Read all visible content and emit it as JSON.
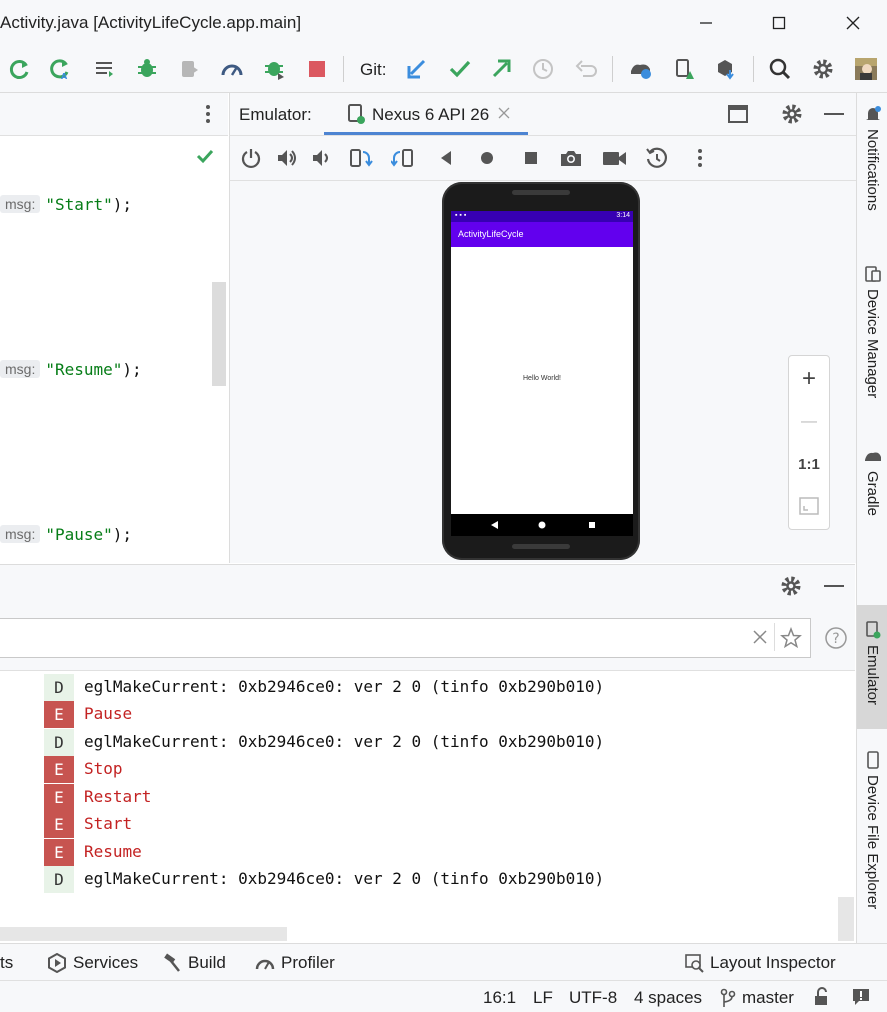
{
  "window": {
    "title": "Activity.java [ActivityLifeCycle.app.main]",
    "minimize_icon": "minimize-icon",
    "maximize_icon": "maximize-icon",
    "close_icon": "close-icon"
  },
  "toolbar": {
    "git_label": "Git:",
    "icons": [
      "rerun-icon",
      "apply-changes-icon",
      "logcat-icon",
      "debug-icon",
      "attach-debugger-icon",
      "profile-icon",
      "debug-attach-icon",
      "stop-icon",
      "git-update-icon",
      "git-commit-icon",
      "git-push-icon",
      "git-history-icon",
      "git-rollback-icon",
      "device-manager-icon",
      "sync-icon",
      "sdk-manager-icon",
      "search-icon",
      "settings-icon",
      "avatar"
    ],
    "accent_green": "#3ba55d",
    "accent_blue": "#3b8ddd",
    "stop_red": "#db5860"
  },
  "editor": {
    "lines": [
      {
        "hint": "msg:",
        "string": "\"Start\"",
        "tail": ");"
      },
      {
        "hint": "msg:",
        "string": "\"Resume\"",
        "tail": ");"
      },
      {
        "hint": "msg:",
        "string": "\"Pause\"",
        "tail": ");"
      }
    ]
  },
  "emulator": {
    "label": "Emulator:",
    "tab_label": "Nexus 6 API 26",
    "controls": [
      "power-icon",
      "volume-up-icon",
      "volume-down-icon",
      "rotate-left-icon",
      "rotate-right-icon",
      "back-icon",
      "home-icon",
      "overview-icon",
      "screenshot-icon",
      "screen-record-icon",
      "snapshot-icon",
      "more-icon"
    ],
    "phone": {
      "status_time": "3:14",
      "app_title": "ActivityLifeCycle",
      "hello_text": "Hello World!",
      "app_bar_color": "#6200ee",
      "status_bar_color": "#3700b3"
    },
    "zoom": {
      "zoom_in": "+",
      "zoom_out": "—",
      "actual_size": "1:1"
    }
  },
  "right_tabs": [
    {
      "label": "Notifications",
      "icon": "bell-icon"
    },
    {
      "label": "Device Manager",
      "icon": "device-manager-icon"
    },
    {
      "label": "Gradle",
      "icon": "gradle-icon"
    },
    {
      "label": "Emulator",
      "icon": "emulator-icon"
    },
    {
      "label": "Device File Explorer",
      "icon": "device-file-explorer-icon"
    }
  ],
  "logcat": {
    "search_placeholder": "",
    "lines": [
      {
        "level": "D",
        "message": "eglMakeCurrent: 0xb2946ce0: ver 2 0 (tinfo 0xb290b010)"
      },
      {
        "level": "E",
        "message": "Pause"
      },
      {
        "level": "D",
        "message": "eglMakeCurrent: 0xb2946ce0: ver 2 0 (tinfo 0xb290b010)"
      },
      {
        "level": "E",
        "message": "Stop"
      },
      {
        "level": "E",
        "message": "Restart"
      },
      {
        "level": "E",
        "message": "Start"
      },
      {
        "level": "E",
        "message": "Resume"
      },
      {
        "level": "D",
        "message": "eglMakeCurrent: 0xb2946ce0: ver 2 0 (tinfo 0xb290b010)"
      }
    ],
    "error_color": "#c75450"
  },
  "bottom_tools": {
    "partial": "ts",
    "services": "Services",
    "build": "Build",
    "profiler": "Profiler",
    "layout_inspector": "Layout Inspector"
  },
  "status_bar": {
    "position": "16:1",
    "line_sep": "LF",
    "encoding": "UTF-8",
    "indent": "4 spaces",
    "branch": "master"
  }
}
